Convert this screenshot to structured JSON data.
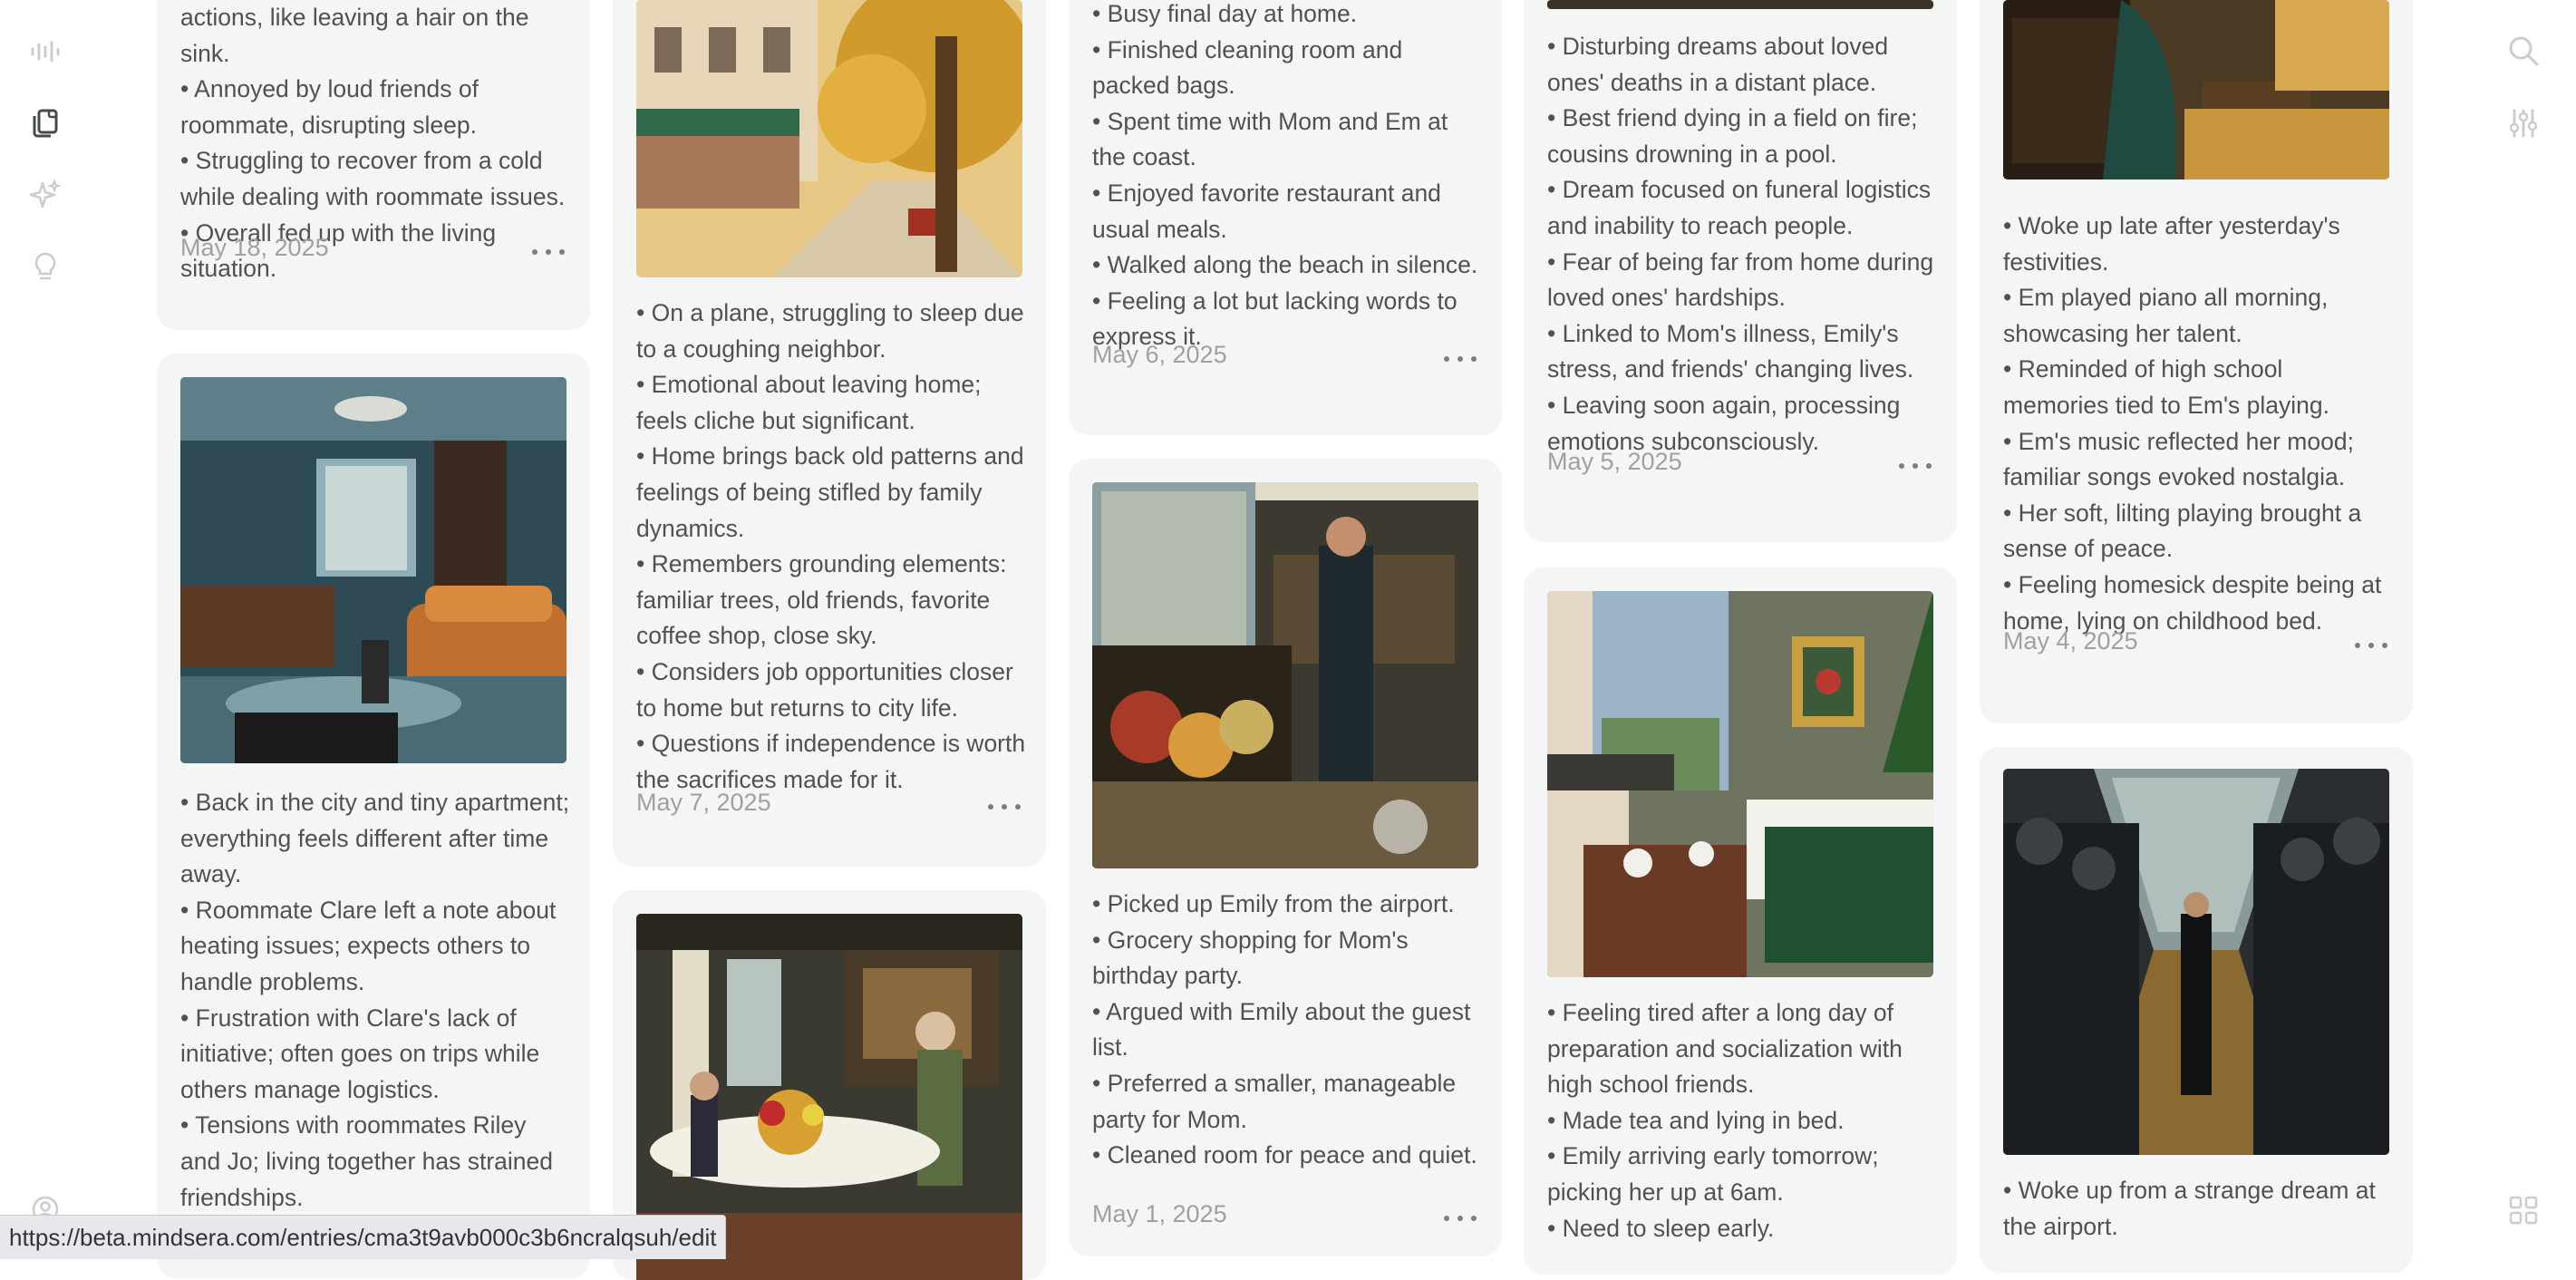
{
  "sidebar": {
    "icons": [
      "waveform-icon",
      "journal-pages-icon",
      "sparkles-icon",
      "lightbulb-icon",
      "profile-icon"
    ]
  },
  "right_toolbar": {
    "icons": [
      "search-icon",
      "filter-sliders-icon",
      "grid-view-icon"
    ]
  },
  "status_url": "https://beta.mindsera.com/entries/cma3t9avb000c3b6ncralqsuh/edit",
  "entries": [
    {
      "id": "c1a",
      "bullets": [
        "actions, like leaving a hair on the sink.",
        "• Annoyed by loud friends of roommate, disrupting sleep.",
        "• Struggling to recover from a cold while dealing with roommate issues.",
        "• Overall fed up with the living situation."
      ],
      "date": "May 18, 2025"
    },
    {
      "id": "c1b",
      "image": "cozy-teal-kitchen-living-room-painting",
      "bullets": [
        "• Back in the city and tiny apartment; everything feels different after time away.",
        "• Roommate Clare left a note about heating issues; expects others to handle problems.",
        "• Frustration with Clare's lack of initiative; often goes on trips while others manage logistics.",
        "• Tensions with roommates Riley and Jo; living together has strained friendships."
      ]
    },
    {
      "id": "c2a",
      "image": "autumn-street-cafe-painting",
      "bullets": [
        "• On a plane, struggling to sleep due to a coughing neighbor.",
        "• Emotional about leaving home; feels cliche but significant.",
        "• Home brings back old patterns and feelings of being stifled by family dynamics.",
        "• Remembers grounding elements: familiar trees, old friends, favorite coffee shop, close sky.",
        "• Considers job opportunities closer to home but returns to city life.",
        "• Questions if independence is worth the sacrifices made for it."
      ],
      "date": "May 7, 2025"
    },
    {
      "id": "c2b",
      "image": "dinner-table-with-flowers-painting"
    },
    {
      "id": "c3a",
      "bullets": [
        "• Busy final day at home.",
        "• Finished cleaning room and packed bags.",
        "• Spent time with Mom and Em at the coast.",
        "• Enjoyed favorite restaurant and usual meals.",
        "• Walked along the beach in silence.",
        "• Feeling a lot but lacking words to express it."
      ],
      "date": "May 6, 2025"
    },
    {
      "id": "c3b",
      "image": "grocery-store-shopper-painting",
      "bullets": [
        "• Picked up Emily from the airport.",
        "• Grocery shopping for Mom's birthday party.",
        "• Argued with Emily about the guest list.",
        "• Preferred a smaller, manageable party for Mom.",
        "• Cleaned room for peace and quiet."
      ],
      "date": "May 1, 2025"
    },
    {
      "id": "c4a",
      "bullets": [
        "• Disturbing dreams about loved ones' deaths in a distant place.",
        "• Best friend dying in a field on fire; cousins drowning in a pool.",
        "• Dream focused on funeral logistics and inability to reach people.",
        "• Fear of being far from home during loved ones' hardships.",
        "• Linked to Mom's illness, Emily's stress, and friends' changing lives.",
        "• Leaving soon again, processing emotions subconsciously."
      ],
      "date": "May 5, 2025"
    },
    {
      "id": "c4b",
      "image": "bedroom-with-tea-and-christmas-tree-painting",
      "bullets": [
        "• Feeling tired after a long day of preparation and socialization with high school friends.",
        "• Made tea and lying in bed.",
        "• Emily arriving early tomorrow; picking her up at 6am.",
        "• Need to sleep early."
      ]
    },
    {
      "id": "c5a",
      "image": "woman-playing-piano-painting",
      "bullets": [
        "• Woke up late after yesterday's festivities.",
        "• Em played piano all morning, showcasing her talent.",
        "• Reminded of high school memories tied to Em's playing.",
        "• Em's music reflected her mood; familiar songs evoked nostalgia.",
        "• Her soft, lilting playing brought a sense of peace.",
        "• Feeling homesick despite being at home, lying on childhood bed."
      ],
      "date": "May 4, 2025"
    },
    {
      "id": "c5b",
      "image": "man-in-suit-among-armored-guards-painting",
      "bullets": [
        "• Woke up from a strange dream at the airport."
      ]
    }
  ]
}
